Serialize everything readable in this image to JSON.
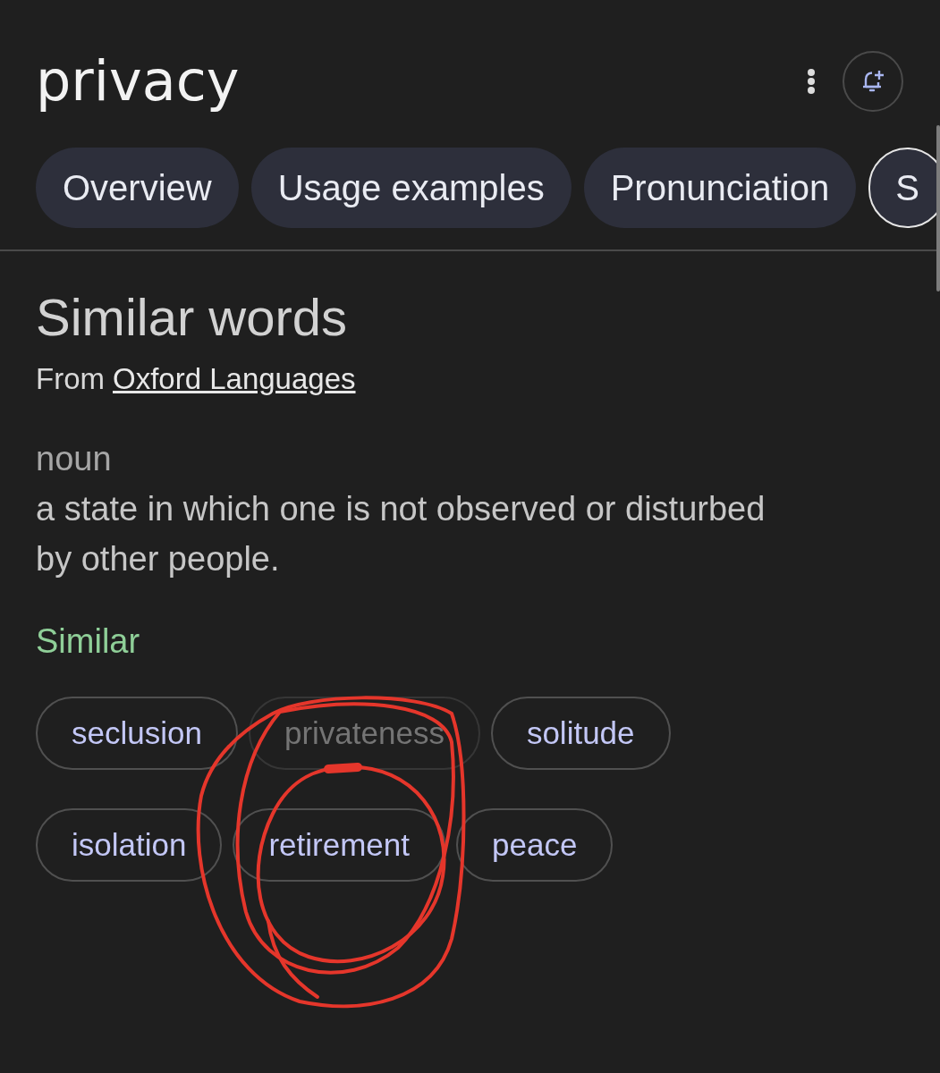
{
  "header": {
    "title": "privacy"
  },
  "tabs": [
    {
      "label": "Overview",
      "selected": false
    },
    {
      "label": "Usage examples",
      "selected": false
    },
    {
      "label": "Pronunciation",
      "selected": false
    },
    {
      "label": "S",
      "selected": true
    }
  ],
  "section": {
    "heading": "Similar words",
    "source_prefix": "From",
    "source_link": "Oxford Languages",
    "part_of_speech": "noun",
    "definition": "a state in which one is not observed or disturbed by other people.",
    "similar_label": "Similar",
    "similar": [
      {
        "word": "seclusion",
        "disabled": false
      },
      {
        "word": "privateness",
        "disabled": true
      },
      {
        "word": "solitude",
        "disabled": false
      },
      {
        "word": "isolation",
        "disabled": false
      },
      {
        "word": "retirement",
        "disabled": false
      },
      {
        "word": "peace",
        "disabled": false
      }
    ]
  }
}
